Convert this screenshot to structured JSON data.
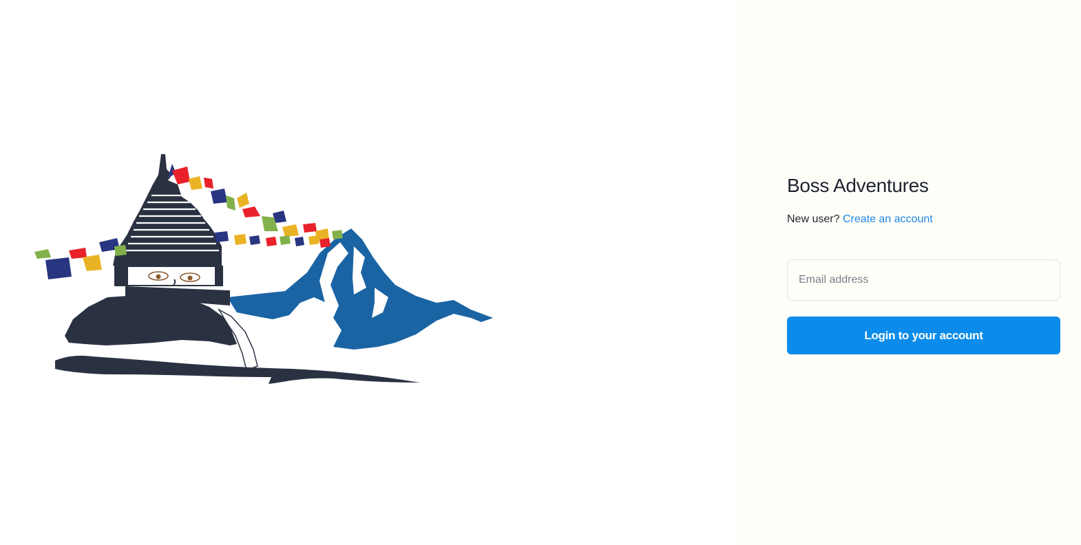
{
  "brand": {
    "title": "Boss Adventures"
  },
  "signup": {
    "prompt": "New user?",
    "link_label": "Create an account"
  },
  "login_form": {
    "email_placeholder": "Email address",
    "email_value": "",
    "submit_label": "Login to your account"
  },
  "hero": {
    "icon": "stupa-mountain-prayer-flags-illustration"
  },
  "colors": {
    "left_background": "#ffffff",
    "right_background": "#fefdf8",
    "accent_link": "#1e86e6",
    "button": "#0b8cea",
    "stupa_dark": "#2a3242",
    "mountain_blue": "#1a64a4",
    "flag_red": "#e8212a",
    "flag_yellow": "#eab325",
    "flag_green": "#82b14b",
    "flag_navy": "#283580"
  }
}
